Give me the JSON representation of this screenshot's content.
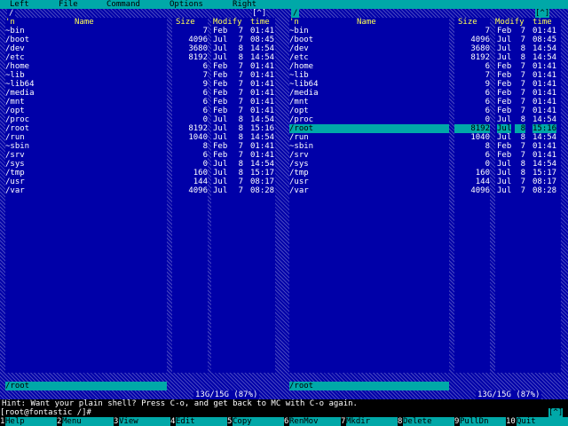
{
  "menu": {
    "left": "Left",
    "file": "File",
    "command": "Command",
    "options": "Options",
    "right": "Right"
  },
  "left_panel": {
    "path": "/",
    "toggle": "[^]",
    "headers": {
      "n": "'n",
      "name": "Name",
      "size": "Size",
      "modify": "Modify",
      "time": "time"
    },
    "rows": [
      {
        "name": "~bin",
        "size": "7",
        "month": "Feb",
        "day": "7",
        "time": "01:41"
      },
      {
        "name": "/boot",
        "size": "4096",
        "month": "Jul",
        "day": "7",
        "time": "08:45"
      },
      {
        "name": "/dev",
        "size": "3680",
        "month": "Jul",
        "day": "8",
        "time": "14:54"
      },
      {
        "name": "/etc",
        "size": "8192",
        "month": "Jul",
        "day": "8",
        "time": "14:54"
      },
      {
        "name": "/home",
        "size": "6",
        "month": "Feb",
        "day": "7",
        "time": "01:41"
      },
      {
        "name": "~lib",
        "size": "7",
        "month": "Feb",
        "day": "7",
        "time": "01:41"
      },
      {
        "name": "~lib64",
        "size": "9",
        "month": "Feb",
        "day": "7",
        "time": "01:41"
      },
      {
        "name": "/media",
        "size": "6",
        "month": "Feb",
        "day": "7",
        "time": "01:41"
      },
      {
        "name": "/mnt",
        "size": "6",
        "month": "Feb",
        "day": "7",
        "time": "01:41"
      },
      {
        "name": "/opt",
        "size": "6",
        "month": "Feb",
        "day": "7",
        "time": "01:41"
      },
      {
        "name": "/proc",
        "size": "0",
        "month": "Jul",
        "day": "8",
        "time": "14:54"
      },
      {
        "name": "/root",
        "size": "8192",
        "month": "Jul",
        "day": "8",
        "time": "15:16"
      },
      {
        "name": "/run",
        "size": "1040",
        "month": "Jul",
        "day": "8",
        "time": "14:54"
      },
      {
        "name": "~sbin",
        "size": "8",
        "month": "Feb",
        "day": "7",
        "time": "01:41"
      },
      {
        "name": "/srv",
        "size": "6",
        "month": "Feb",
        "day": "7",
        "time": "01:41"
      },
      {
        "name": "/sys",
        "size": "0",
        "month": "Jul",
        "day": "8",
        "time": "14:54"
      },
      {
        "name": "/tmp",
        "size": "160",
        "month": "Jul",
        "day": "8",
        "time": "15:17"
      },
      {
        "name": "/usr",
        "size": "144",
        "month": "Jul",
        "day": "7",
        "time": "08:17"
      },
      {
        "name": "/var",
        "size": "4096",
        "month": "Jul",
        "day": "7",
        "time": "08:28"
      }
    ],
    "current": "/root",
    "disk": "13G/15G (87%)"
  },
  "right_panel": {
    "path": "/",
    "toggle": "[^]",
    "headers": {
      "n": "'n",
      "name": "Name",
      "size": "Size",
      "modify": "Modify",
      "time": "time"
    },
    "rows": [
      {
        "name": "~bin",
        "size": "7",
        "month": "Feb",
        "day": "7",
        "time": "01:41"
      },
      {
        "name": "/boot",
        "size": "4096",
        "month": "Jul",
        "day": "7",
        "time": "08:45"
      },
      {
        "name": "/dev",
        "size": "3680",
        "month": "Jul",
        "day": "8",
        "time": "14:54"
      },
      {
        "name": "/etc",
        "size": "8192",
        "month": "Jul",
        "day": "8",
        "time": "14:54"
      },
      {
        "name": "/home",
        "size": "6",
        "month": "Feb",
        "day": "7",
        "time": "01:41"
      },
      {
        "name": "~lib",
        "size": "7",
        "month": "Feb",
        "day": "7",
        "time": "01:41"
      },
      {
        "name": "~lib64",
        "size": "9",
        "month": "Feb",
        "day": "7",
        "time": "01:41"
      },
      {
        "name": "/media",
        "size": "6",
        "month": "Feb",
        "day": "7",
        "time": "01:41"
      },
      {
        "name": "/mnt",
        "size": "6",
        "month": "Feb",
        "day": "7",
        "time": "01:41"
      },
      {
        "name": "/opt",
        "size": "6",
        "month": "Feb",
        "day": "7",
        "time": "01:41"
      },
      {
        "name": "/proc",
        "size": "0",
        "month": "Jul",
        "day": "8",
        "time": "14:54"
      },
      {
        "name": "/root",
        "size": "8192",
        "month": "Jul",
        "day": "8",
        "time": "15:16"
      },
      {
        "name": "/run",
        "size": "1040",
        "month": "Jul",
        "day": "8",
        "time": "14:54"
      },
      {
        "name": "~sbin",
        "size": "8",
        "month": "Feb",
        "day": "7",
        "time": "01:41"
      },
      {
        "name": "/srv",
        "size": "6",
        "month": "Feb",
        "day": "7",
        "time": "01:41"
      },
      {
        "name": "/sys",
        "size": "0",
        "month": "Jul",
        "day": "8",
        "time": "14:54"
      },
      {
        "name": "/tmp",
        "size": "160",
        "month": "Jul",
        "day": "8",
        "time": "15:17"
      },
      {
        "name": "/usr",
        "size": "144",
        "month": "Jul",
        "day": "7",
        "time": "08:17"
      },
      {
        "name": "/var",
        "size": "4096",
        "month": "Jul",
        "day": "7",
        "time": "08:28"
      }
    ],
    "selected_index": 11,
    "current": "/root",
    "disk": "13G/15G (87%)"
  },
  "hint": "Hint: Want your plain shell? Press C-o, and get back to MC with C-o again.",
  "prompt": "[root@fontastic /]#",
  "prompt_toggle": "[^]",
  "fkeys": [
    {
      "num": "1",
      "label": "Help"
    },
    {
      "num": "2",
      "label": "Menu"
    },
    {
      "num": "3",
      "label": "View"
    },
    {
      "num": "4",
      "label": "Edit"
    },
    {
      "num": "5",
      "label": "Copy"
    },
    {
      "num": "6",
      "label": "RenMov"
    },
    {
      "num": "7",
      "label": "Mkdir"
    },
    {
      "num": "8",
      "label": "Delete"
    },
    {
      "num": "9",
      "label": "PullDn"
    },
    {
      "num": "10",
      "label": "Quit"
    }
  ],
  "colors": {
    "panel": "#0000a8",
    "accent": "#00a8a8",
    "header": "#ffff55",
    "text": "#ffffff"
  }
}
